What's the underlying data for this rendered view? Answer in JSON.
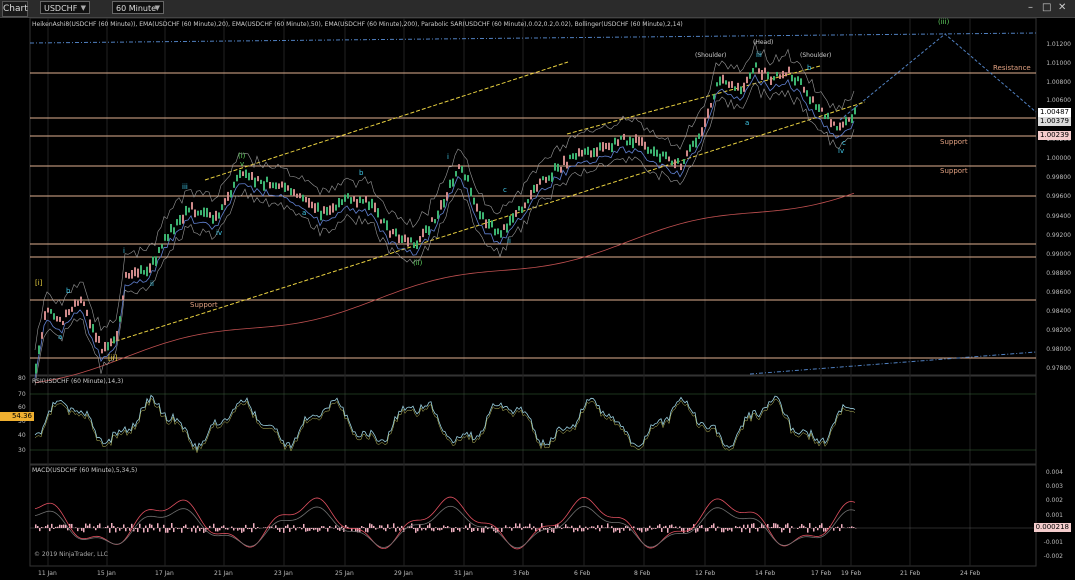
{
  "toolbar": {
    "chart_tab": "Chart",
    "instrument": "USDCHF",
    "interval": "60 Minute"
  },
  "price_panel": {
    "indicators_label": "HeikenAshi8(USDCHF (60 Minute)), EMA(USDCHF (60 Minute),20), EMA(USDCHF (60 Minute),50), EMA(USDCHF (60 Minute),200), Parabolic SAR(USDCHF (60 Minute),0.02,0.2,0.02), Bollinger(USDCHF (60 Minute),2,14)",
    "y_ticks": [
      "1.01200",
      "1.01000",
      "1.00800",
      "1.00600",
      "1.00200",
      "1.00000",
      "0.99800",
      "0.99600",
      "0.99400",
      "0.99200",
      "0.99000",
      "0.98800",
      "0.98600",
      "0.98400",
      "0.98200",
      "0.98000",
      "0.97800"
    ],
    "price_boxes": [
      {
        "value": "1.00487",
        "color": "#ffffff"
      },
      {
        "value": "1.00379",
        "color": "#d9d9d9"
      },
      {
        "value": "1.00239",
        "color": "#f4cccc"
      }
    ],
    "annotations": {
      "resistance": "Resistance",
      "support_1": "Support",
      "support_2": "Support",
      "support_3": "Support",
      "head": "(Head)",
      "shoulder_left": "(Shoulder)",
      "shoulder_right": "(Shoulder)",
      "wave_i_green": "(i)",
      "wave_ii_green": "(ii)",
      "wave_iii_green": "(iii)",
      "wave_v_green": "v",
      "wave_i_yellow": "[i]",
      "wave_ii_yellow": "[ii]",
      "w_i": "i",
      "w_ii": "ii",
      "w_iii": "iii",
      "w_iv": "iv",
      "w_a": "a",
      "w_b": "b",
      "w_c": "c",
      "w_b2": "b",
      "w_a2": "a",
      "w_i2": "i",
      "w_ii2": "ii",
      "w_iii2": "iii",
      "w_iv2": "iv",
      "w_c2": "c",
      "w_a3": "a",
      "w_b3": "b"
    }
  },
  "rsi_panel": {
    "label": "RSI(USDCHF (60 Minute),14,3)",
    "y_ticks": [
      "80",
      "70",
      "60",
      "50",
      "40",
      "30"
    ],
    "current_value": "54.36"
  },
  "macd_panel": {
    "label": "MACD(USDCHF (60 Minute),5,34,5)",
    "y_ticks": [
      "0.004",
      "0.003",
      "0.002",
      "0.001",
      "-0.001",
      "-0.002"
    ],
    "current_value": "0.000218",
    "copyright": "© 2019 NinjaTrader, LLC"
  },
  "x_axis": [
    "11 Jan",
    "15 Jan",
    "17 Jan",
    "21 Jan",
    "23 Jan",
    "25 Jan",
    "29 Jan",
    "31 Jan",
    "3 Feb",
    "6 Feb",
    "8 Feb",
    "12 Feb",
    "14 Feb",
    "17 Feb",
    "19 Feb",
    "21 Feb",
    "24 Feb"
  ],
  "colors": {
    "background": "#000000",
    "heiken_up": "#3cb371",
    "heiken_down": "#d08a8a",
    "sar": "#f0b030",
    "channel": "#e8d040",
    "resistance": "#e0a080",
    "wave_green": "#60d060",
    "wave_cyan": "#40c8e8",
    "rsi_line": "#8fd0e0",
    "macd_hist": "#f0b0c0",
    "macd_line": "#e05060"
  }
}
